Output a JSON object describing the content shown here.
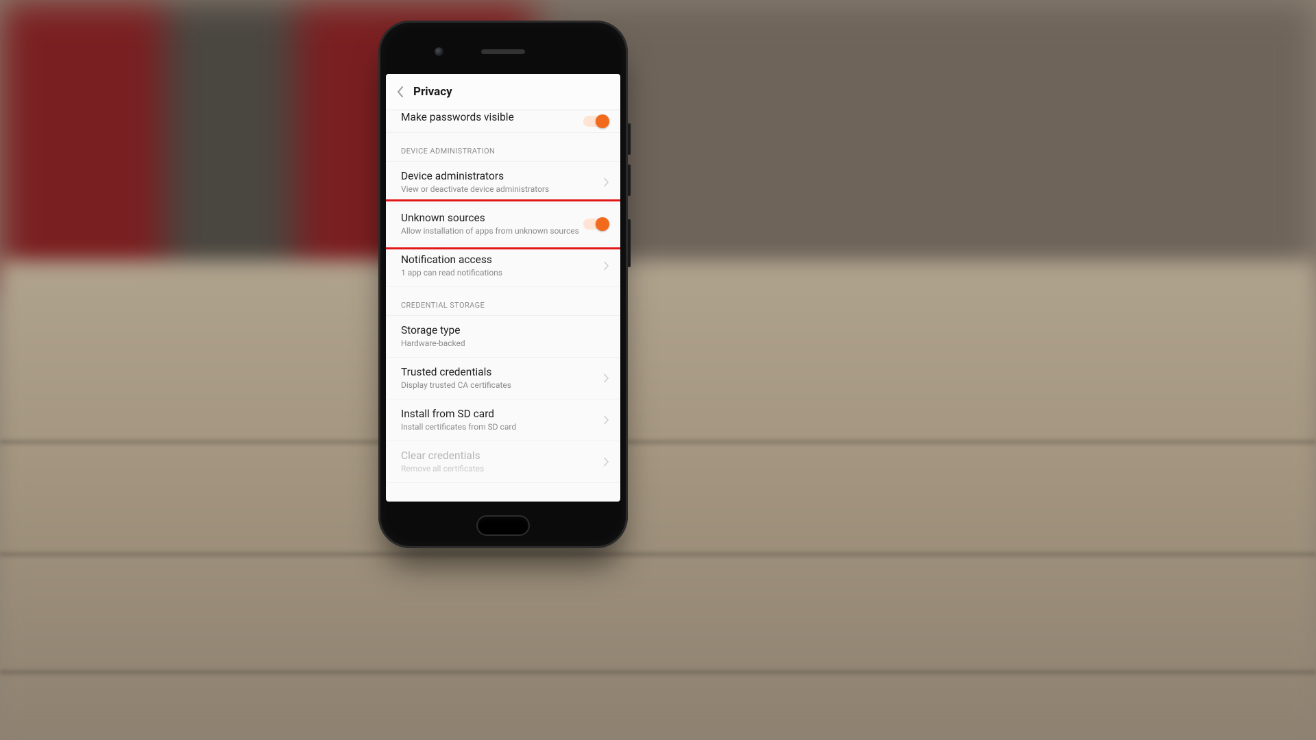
{
  "colors": {
    "accent": "#f26a1b",
    "highlight": "#e11616"
  },
  "titlebar": {
    "title": "Privacy"
  },
  "rows": {
    "make_passwords_visible": {
      "label": "Make passwords visible",
      "toggle_on": true
    },
    "device_admin_section": "DEVICE ADMINISTRATION",
    "device_administrators": {
      "label": "Device administrators",
      "sub": "View or deactivate device administrators"
    },
    "unknown_sources": {
      "label": "Unknown sources",
      "sub": "Allow installation of apps from unknown sources",
      "toggle_on": true,
      "highlighted": true
    },
    "notification_access": {
      "label": "Notification access",
      "sub": "1 app can read notifications"
    },
    "credential_storage_section": "CREDENTIAL STORAGE",
    "storage_type": {
      "label": "Storage type",
      "sub": "Hardware-backed"
    },
    "trusted_credentials": {
      "label": "Trusted credentials",
      "sub": "Display trusted CA certificates"
    },
    "install_from_sd": {
      "label": "Install from SD card",
      "sub": "Install certificates from SD card"
    },
    "clear_credentials": {
      "label": "Clear credentials",
      "sub": "Remove all certificates"
    }
  }
}
